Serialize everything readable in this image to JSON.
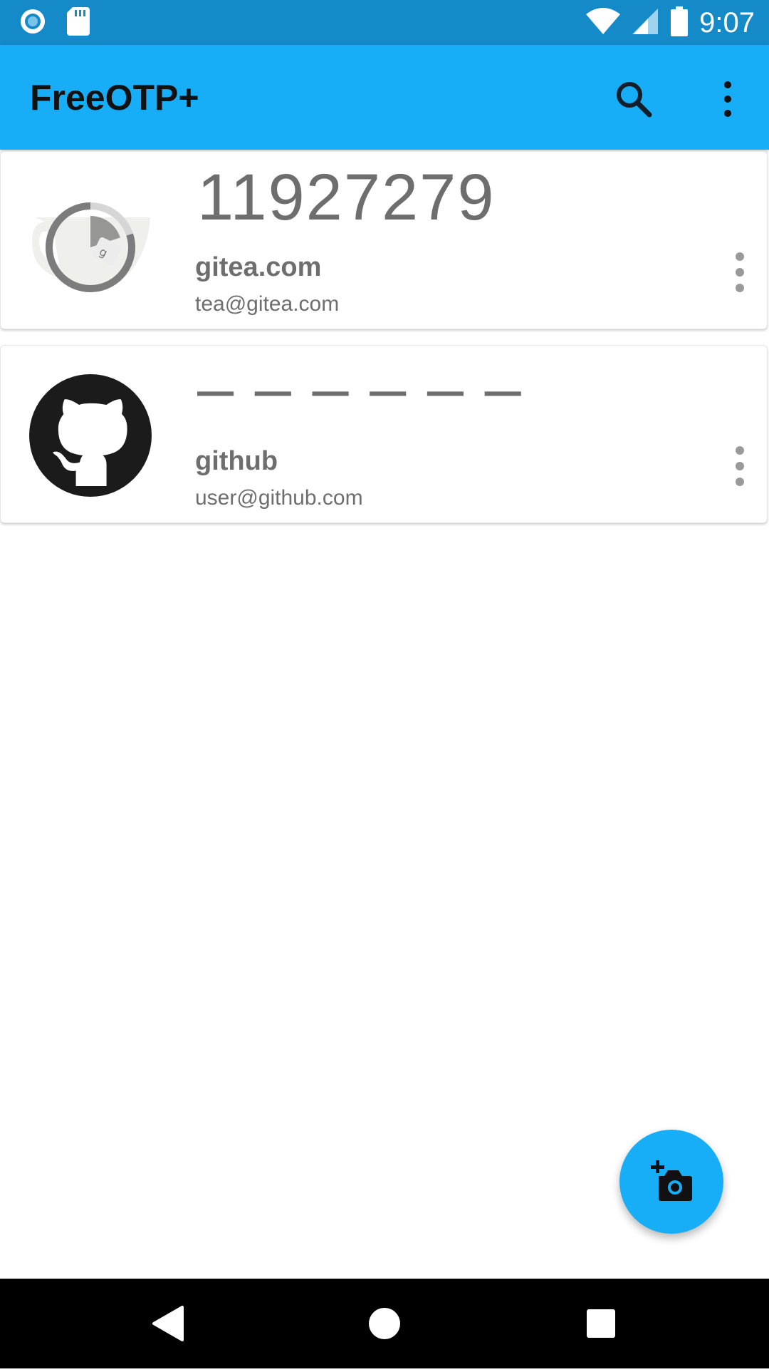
{
  "status_bar": {
    "time": "9:07",
    "left_icons": [
      "record-icon",
      "sd-card-icon"
    ],
    "right_icons": [
      "wifi-icon",
      "cell-signal-icon",
      "battery-icon"
    ]
  },
  "app_bar": {
    "title": "FreeOTP+",
    "actions": [
      "search-icon",
      "overflow-menu-icon"
    ]
  },
  "tokens": [
    {
      "code": "11927279",
      "issuer": "gitea.com",
      "account": "tea@gitea.com",
      "logo": "gitea-logo",
      "timer_remaining_fraction": 0.8
    },
    {
      "code": "– – – – – –",
      "issuer": "github",
      "account": "user@github.com",
      "logo": "github-logo"
    }
  ],
  "fab": {
    "icon": "add-camera-icon"
  },
  "nav_bar": {
    "buttons": [
      "back-icon",
      "home-icon",
      "recents-icon"
    ]
  },
  "colors": {
    "status_bar": "#148BC8",
    "app_bar": "#17AEF7",
    "fab": "#17AEF7",
    "text_secondary": "#6e6e6e"
  }
}
